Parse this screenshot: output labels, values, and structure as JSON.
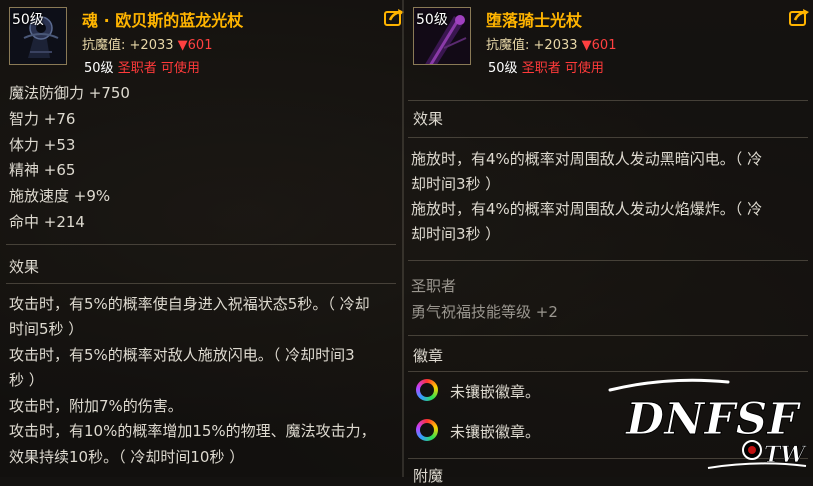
{
  "left_item": {
    "level_badge": "50级",
    "name": "魂 · 欧贝斯的蓝龙光杖",
    "anti_magic_label": "抗魔值:",
    "anti_magic_value": "+2033",
    "anti_magic_delta": "▼601",
    "req_level": "50级",
    "req_class": "圣职者 可使用",
    "stats": [
      "魔法防御力 +750",
      "智力 +76",
      "体力 +53",
      "精神 +65",
      "施放速度 +9%",
      "命中 +214"
    ],
    "effect_title": "效果",
    "effect_lines": [
      "攻击时，有5%的概率使自身进入祝福状态5秒。（ 冷却",
      "时间5秒 ）",
      "攻击时，有5%的概率对敌人施放闪电。（ 冷却时间3",
      "秒 ）",
      "攻击时，附加7%的伤害。",
      "攻击时，有10%的概率增加15%的物理、魔法攻击力，",
      "效果持续10秒。（ 冷却时间10秒 ）"
    ]
  },
  "right_item": {
    "level_badge": "50级",
    "name": "堕落骑士光杖",
    "anti_magic_label": "抗魔值:",
    "anti_magic_value": "+2033",
    "anti_magic_delta": "▼601",
    "req_level": "50级",
    "req_class": "圣职者 可使用",
    "effect_title": "效果",
    "effect_lines": [
      "施放时，有4%的概率对周围敌人发动黑暗闪电。（ 冷",
      "却时间3秒 ）",
      "施放时，有4%的概率对周围敌人发动火焰爆炸。（ 冷",
      "却时间3秒 ）"
    ],
    "class_title": "圣职者",
    "class_bonus": "勇气祝福技能等级 +2",
    "emblem_title": "徽章",
    "emblem_slots": [
      "未镶嵌徽章。",
      "未镶嵌徽章。"
    ],
    "enchant_title": "附魔"
  },
  "watermark": {
    "brand": "DNFSF",
    "suffix": "TW"
  },
  "colors": {
    "item_name": "#ffb400",
    "class_requirement": "#ff3a3a",
    "delta_down": "#ff4040",
    "body_text": "#dedad0"
  }
}
